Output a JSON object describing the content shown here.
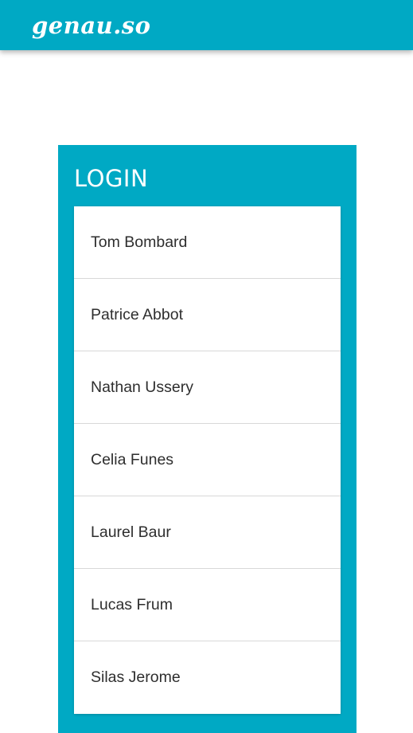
{
  "header": {
    "logo_text": "genau.so",
    "accent_color": "#00a9c4"
  },
  "login": {
    "title": "LOGIN",
    "users": [
      {
        "name": "Tom Bombard"
      },
      {
        "name": "Patrice Abbot"
      },
      {
        "name": "Nathan Ussery"
      },
      {
        "name": "Celia Funes"
      },
      {
        "name": "Laurel Baur"
      },
      {
        "name": "Lucas Frum"
      },
      {
        "name": "Silas Jerome"
      }
    ]
  }
}
